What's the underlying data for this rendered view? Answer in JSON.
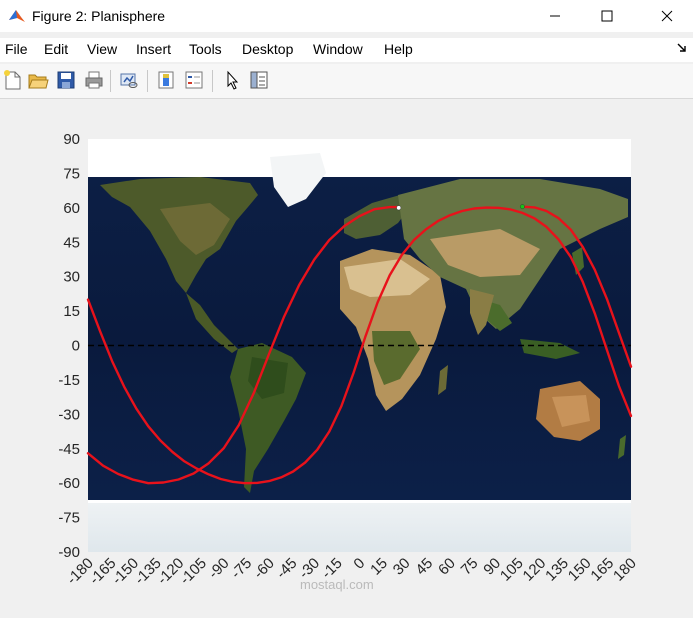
{
  "window": {
    "title": "Figure 2: Planisphere",
    "minimize_icon": "minimize-icon",
    "maximize_icon": "maximize-icon",
    "close_icon": "close-icon"
  },
  "menu": {
    "items": [
      "File",
      "Edit",
      "View",
      "Insert",
      "Tools",
      "Desktop",
      "Window",
      "Help"
    ]
  },
  "toolbar": {
    "icons": [
      "new-figure-icon",
      "open-file-icon",
      "save-icon",
      "print-icon",
      "link-plot-icon",
      "colorbar-icon",
      "legend-icon",
      "pointer-icon",
      "property-editor-icon"
    ]
  },
  "watermark": "mostaql.com",
  "chart_data": {
    "type": "line",
    "background": "world map (equirectangular)",
    "xlim": [
      -180,
      180
    ],
    "ylim": [
      -90,
      90
    ],
    "xticks": [
      -180,
      -165,
      -150,
      -135,
      -120,
      -105,
      -90,
      -75,
      -60,
      -45,
      -30,
      -15,
      0,
      15,
      30,
      45,
      60,
      75,
      90,
      105,
      120,
      135,
      150,
      165,
      180
    ],
    "yticks": [
      90,
      75,
      60,
      45,
      30,
      15,
      0,
      -15,
      -30,
      -45,
      -60,
      -75,
      -90
    ],
    "equator_line": {
      "y": 0,
      "style": "dashed",
      "color": "#000000"
    },
    "series": [
      {
        "color": "#e8121b",
        "x": [
          -180,
          -170,
          -160,
          -150,
          -140,
          -130,
          -120,
          -110,
          -100,
          -90,
          -80,
          -70,
          -60,
          -50,
          -40,
          -30,
          -20,
          -10,
          0,
          10,
          20,
          26
        ],
        "y": [
          -47,
          -52.4,
          -56,
          -58.5,
          -60,
          -59.7,
          -58.4,
          -55.8,
          -51.3,
          -44.7,
          -34.7,
          -20.6,
          -3.7,
          12.6,
          26.4,
          37.5,
          46,
          52.1,
          56.4,
          59.4,
          60.3,
          60.3
        ]
      },
      {
        "color": "#e8121b",
        "x": [
          -180,
          -172,
          -164,
          -156,
          -148,
          -140,
          -132,
          -124,
          -116,
          -108,
          -100,
          -92,
          -84,
          -76,
          -68,
          -60,
          -52,
          -44,
          -36,
          -28,
          -20,
          -12,
          -4,
          4,
          12,
          20,
          28,
          36,
          44,
          52,
          60,
          68,
          76,
          84,
          92,
          100,
          108,
          116,
          124,
          132,
          140,
          148,
          156,
          164,
          172,
          180
        ],
        "y": [
          20,
          6.2,
          -6.8,
          -18,
          -27.5,
          -35.2,
          -41.4,
          -46.4,
          -50.5,
          -53.6,
          -56.2,
          -58.2,
          -59.4,
          -60,
          -59.9,
          -59.1,
          -57.5,
          -54.9,
          -51,
          -45.4,
          -37.5,
          -26.4,
          -12,
          4,
          18.8,
          30.6,
          39.4,
          45.9,
          50.6,
          54.2,
          56.8,
          58.6,
          59.7,
          60.1,
          60,
          59.3,
          57.8,
          55.4,
          51.7,
          46.2,
          38.6,
          27.8,
          14,
          -1.9,
          -17.6,
          -30.7
        ]
      },
      {
        "color": "#e8121b",
        "x": [
          108,
          116,
          124,
          132,
          140,
          148,
          156,
          164,
          172,
          180
        ],
        "y": [
          60.5,
          60.2,
          58.6,
          55.5,
          50.5,
          43,
          33,
          20.3,
          5.6,
          -9.2
        ]
      }
    ],
    "markers": [
      {
        "x": 26,
        "y": 60,
        "color": "#ffffff"
      },
      {
        "x": 108,
        "y": 60.5,
        "color": "#19c419"
      }
    ]
  }
}
